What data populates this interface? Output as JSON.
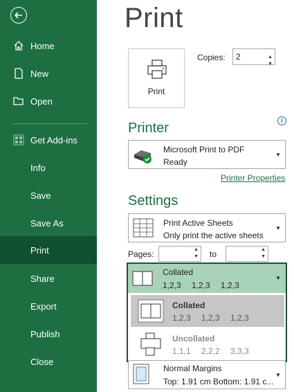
{
  "sidebar": {
    "items": [
      {
        "label": "Home",
        "icon": "home-icon"
      },
      {
        "label": "New",
        "icon": "new-document-icon"
      },
      {
        "label": "Open",
        "icon": "open-folder-icon"
      },
      {
        "label": "Get Add-ins",
        "icon": "add-ins-icon"
      },
      {
        "label": "Info"
      },
      {
        "label": "Save"
      },
      {
        "label": "Save As"
      },
      {
        "label": "Print",
        "active": true
      },
      {
        "label": "Share"
      },
      {
        "label": "Export"
      },
      {
        "label": "Publish"
      },
      {
        "label": "Close"
      }
    ]
  },
  "main": {
    "title": "Print",
    "print_button_label": "Print",
    "copies_label": "Copies:",
    "copies_value": "2",
    "printer": {
      "section_title": "Printer",
      "name": "Microsoft Print to PDF",
      "status": "Ready",
      "properties_link": "Printer Properties"
    },
    "settings": {
      "section_title": "Settings",
      "print_what": {
        "line1": "Print Active Sheets",
        "line2": "Only print the active sheets"
      },
      "pages_label": "Pages:",
      "to_label": "to",
      "collation": {
        "line1": "Collated",
        "line2": "1,2,3 1,2,3 1,2,3"
      },
      "collation_options": [
        {
          "title": "Collated",
          "detail": "1,2,3 1,2,3 1,2,3",
          "selected": true
        },
        {
          "title": "Uncollated",
          "detail": "1,1,1 2,2,2 3,3,3",
          "selected": false
        }
      ],
      "margins": {
        "line1": "Normal Margins",
        "line2": "Top: 1.91 cm Bottom: 1.91 c..."
      }
    }
  },
  "colors": {
    "accent": "#1d6f42",
    "sidebar_active": "#0f5130",
    "highlight": "#a9d3b8"
  }
}
